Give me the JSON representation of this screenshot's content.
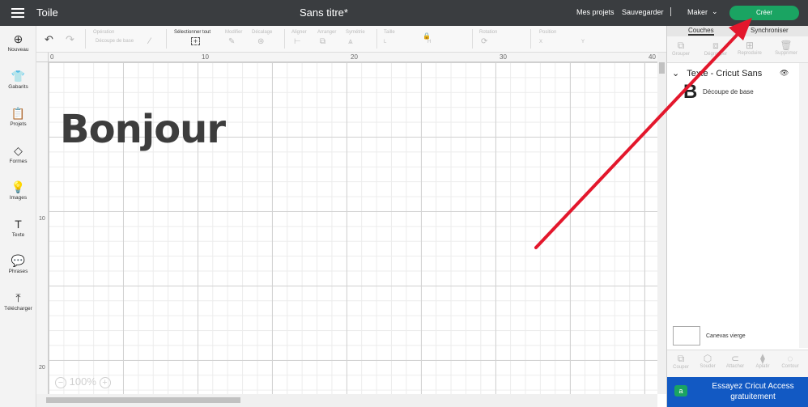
{
  "topbar": {
    "app_title": "Toile",
    "doc_title": "Sans titre*",
    "my_projects": "Mes projets",
    "save": "Sauvegarder",
    "separator": "|",
    "machine": "Maker",
    "create": "Créer"
  },
  "leftnav": {
    "items": [
      {
        "label": "Nouveau",
        "icon": "⊕"
      },
      {
        "label": "Gabarits",
        "icon": "👕"
      },
      {
        "label": "Projets",
        "icon": "📋"
      },
      {
        "label": "Formes",
        "icon": "◇"
      },
      {
        "label": "Images",
        "icon": "💡"
      },
      {
        "label": "Texte",
        "icon": "T"
      },
      {
        "label": "Phrases",
        "icon": "💬"
      },
      {
        "label": "Télécharger",
        "icon": "⤒"
      }
    ]
  },
  "toolbar": {
    "operation": "Opération",
    "operation_value": "Découpe de base",
    "select_all": "Sélectionner tout",
    "edit": "Modifier",
    "offset": "Décalage",
    "align": "Aligner",
    "arrange": "Arranger",
    "symmetry": "Symétrie",
    "size": "Taille",
    "size_w": "L",
    "size_h": "H",
    "rotation": "Rotation",
    "position": "Position",
    "pos_x": "X",
    "pos_y": "Y"
  },
  "canvas": {
    "text": "Bonjour",
    "ruler_top": [
      "0",
      "10",
      "20",
      "30",
      "40"
    ],
    "ruler_left": [
      "10",
      "20"
    ],
    "zoom": "100%"
  },
  "rightpanel": {
    "tabs": [
      "Couches",
      "Synchroniser"
    ],
    "tools": [
      "Grouper",
      "Dégrouper",
      "Reproduire",
      "Supprimer"
    ],
    "layer_title": "Texte - Cricut Sans",
    "layer_letter": "B",
    "layer_op": "Découpe de base",
    "blank_canvas": "Canevas vierge",
    "bottom_tools": [
      "Couper",
      "Souder",
      "Attacher",
      "Aplatir",
      "Contour"
    ],
    "access_line1": "Essayez Cricut Access",
    "access_line2": "gratuitement",
    "access_logo": "a"
  },
  "colors": {
    "topbar": "#3a3d40",
    "create": "#1aa462",
    "access": "#1259c3",
    "arrow": "#e3172c"
  }
}
